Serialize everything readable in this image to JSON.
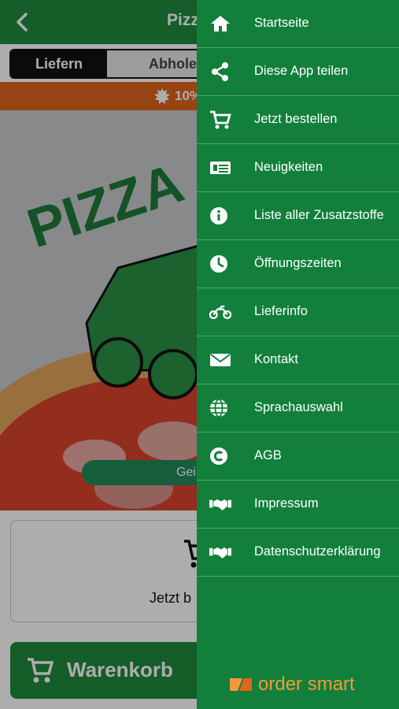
{
  "header": {
    "title": "Pizz"
  },
  "order_mode": {
    "deliver_label": "Liefern",
    "pickup_label": "Abholen"
  },
  "promo": {
    "text": "10%"
  },
  "status_pill": {
    "text": "Gei"
  },
  "order_card": {
    "label": "Jetzt b"
  },
  "cart_button": {
    "label": "Warenkorb"
  },
  "drawer": {
    "items": [
      {
        "label": "Startseite",
        "icon": "home-icon"
      },
      {
        "label": "Diese App teilen",
        "icon": "share-icon"
      },
      {
        "label": "Jetzt bestellen",
        "icon": "cart-icon"
      },
      {
        "label": "Neuigkeiten",
        "icon": "newspaper-icon"
      },
      {
        "label": "Liste aller Zusatzstoffe",
        "icon": "info-icon"
      },
      {
        "label": "Öffnungszeiten",
        "icon": "clock-icon"
      },
      {
        "label": "Lieferinfo",
        "icon": "motorbike-icon"
      },
      {
        "label": "Kontakt",
        "icon": "mail-icon"
      },
      {
        "label": "Sprachauswahl",
        "icon": "globe-icon"
      },
      {
        "label": "AGB",
        "icon": "copyright-icon"
      },
      {
        "label": "Impressum",
        "icon": "handshake-icon"
      },
      {
        "label": "Datenschutzerklärung",
        "icon": "handshake-icon"
      }
    ],
    "footer_brand": "order smart"
  },
  "colors": {
    "brand_green": "#1f8a3d",
    "drawer_green": "#12803b",
    "promo_orange": "#e0641c",
    "logo_orange": "#f29a3a"
  }
}
